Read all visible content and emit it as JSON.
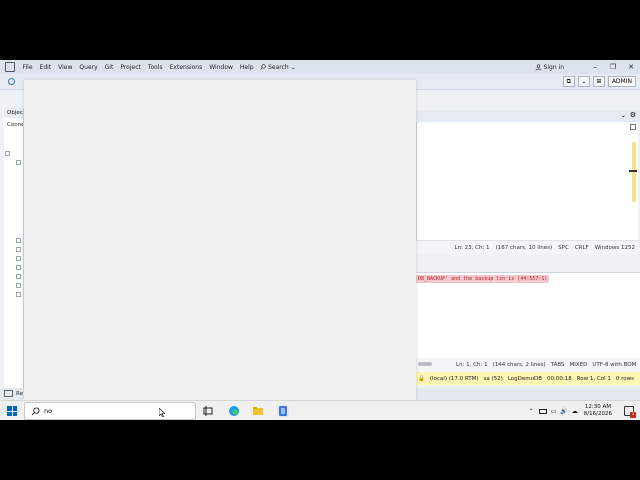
{
  "menubar": {
    "items": [
      "File",
      "Edit",
      "View",
      "Query",
      "Git",
      "Project",
      "Tools",
      "Extensions",
      "Window",
      "Help"
    ],
    "search_label": "Search",
    "signin_label": "Sign in"
  },
  "toolbar": {
    "admin_label": "ADMIN"
  },
  "object_explorer": {
    "header": "Object",
    "conn_label": "Conne"
  },
  "editor_status": {
    "position": "Ln: 23, Ch: 1",
    "chars": "(167 chars, 10 lines)",
    "whitespace": "SPC",
    "line_ending": "CRLF",
    "encoding": "Windows 1252"
  },
  "messages": {
    "line": "DB_BACKUP' and the backup lsn is (44:557:1)"
  },
  "messages_status": {
    "position": "Ln: 1, Ch: 1",
    "chars": "(144 chars, 2 lines)",
    "whitespace": "TABS",
    "line_ending": "MIXED",
    "encoding": "UTF-8 with BOM"
  },
  "query_status": {
    "server": "(local) (17.0 RTM)",
    "user": "sa (52)",
    "database": "LogDemoDB",
    "elapsed": "00:00:18",
    "cursor": "Row 1, Col 1",
    "rows": "0 rows"
  },
  "app_status": {
    "ready": "Re"
  },
  "taskbar": {
    "search_value": "no",
    "time": "12:30 AM",
    "date": "8/16/2026",
    "notif_count": "1"
  },
  "colors": {
    "accent": "#0067c0",
    "query_status_bg": "#fff6b3",
    "error_text": "#b22222"
  }
}
